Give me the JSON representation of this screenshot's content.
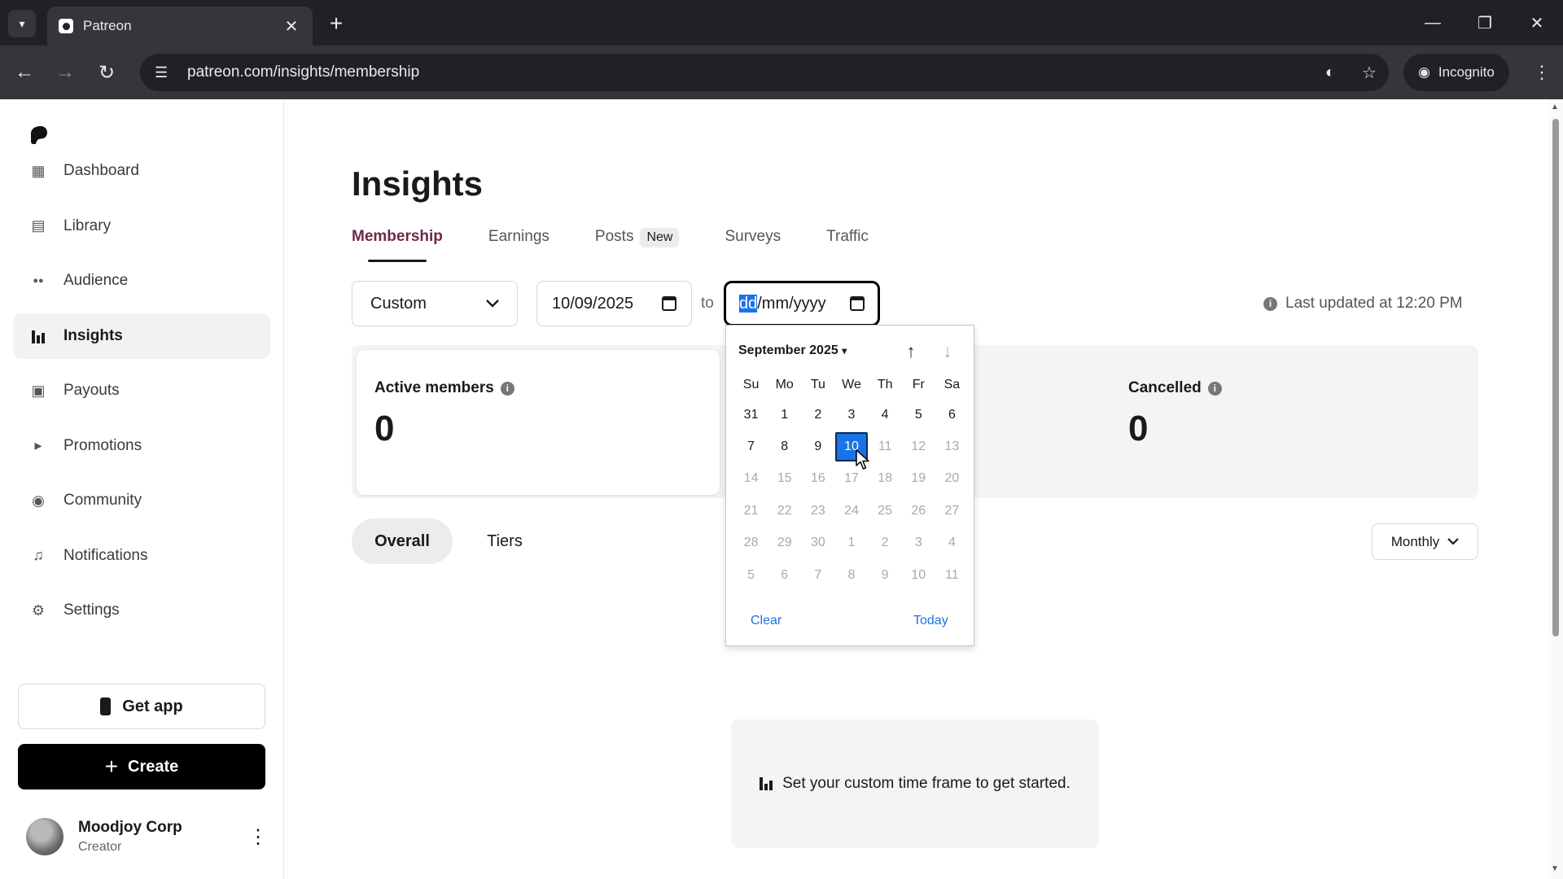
{
  "browser": {
    "tab_title": "Patreon",
    "url": "patreon.com/insights/membership",
    "incognito_label": "Incognito"
  },
  "sidebar": {
    "items": [
      {
        "label": "Dashboard",
        "icon": "dashboard-icon"
      },
      {
        "label": "Library",
        "icon": "library-icon"
      },
      {
        "label": "Audience",
        "icon": "audience-icon"
      },
      {
        "label": "Insights",
        "icon": "insights-icon",
        "active": true
      },
      {
        "label": "Payouts",
        "icon": "payouts-icon"
      },
      {
        "label": "Promotions",
        "icon": "promotions-icon"
      },
      {
        "label": "Community",
        "icon": "community-icon"
      },
      {
        "label": "Notifications",
        "icon": "bell-icon"
      },
      {
        "label": "Settings",
        "icon": "gear-icon"
      }
    ],
    "get_app_label": "Get app",
    "create_label": "Create",
    "profile": {
      "name": "Moodjoy Corp",
      "role": "Creator"
    }
  },
  "main": {
    "title": "Insights",
    "tabs": [
      {
        "label": "Membership",
        "active": true
      },
      {
        "label": "Earnings"
      },
      {
        "label": "Posts",
        "badge": "New"
      },
      {
        "label": "Surveys"
      },
      {
        "label": "Traffic"
      }
    ],
    "range_select": "Custom",
    "date_from": "10/09/2025",
    "to_label": "to",
    "date_to": {
      "dd": "dd",
      "rest": "/mm/yyyy"
    },
    "last_updated": "Last updated at 12:20 PM",
    "stats": {
      "active_members": {
        "label": "Active members",
        "value": "0"
      },
      "cancelled": {
        "label": "Cancelled",
        "value": "0"
      }
    },
    "segments": {
      "overall": "Overall",
      "tiers": "Tiers"
    },
    "interval": "Monthly",
    "empty_message": "Set your custom time frame to get started."
  },
  "calendar": {
    "month_label": "September 2025",
    "weekdays": [
      "Su",
      "Mo",
      "Tu",
      "We",
      "Th",
      "Fr",
      "Sa"
    ],
    "days": [
      {
        "d": "31",
        "muted": false
      },
      {
        "d": "1",
        "muted": false
      },
      {
        "d": "2",
        "muted": false
      },
      {
        "d": "3",
        "muted": false
      },
      {
        "d": "4",
        "muted": false
      },
      {
        "d": "5",
        "muted": false
      },
      {
        "d": "6",
        "muted": false
      },
      {
        "d": "7",
        "muted": false
      },
      {
        "d": "8",
        "muted": false
      },
      {
        "d": "9",
        "muted": false
      },
      {
        "d": "10",
        "muted": false,
        "selected": true
      },
      {
        "d": "11",
        "muted": true
      },
      {
        "d": "12",
        "muted": true
      },
      {
        "d": "13",
        "muted": true
      },
      {
        "d": "14",
        "muted": true
      },
      {
        "d": "15",
        "muted": true
      },
      {
        "d": "16",
        "muted": true
      },
      {
        "d": "17",
        "muted": true
      },
      {
        "d": "18",
        "muted": true
      },
      {
        "d": "19",
        "muted": true
      },
      {
        "d": "20",
        "muted": true
      },
      {
        "d": "21",
        "muted": true
      },
      {
        "d": "22",
        "muted": true
      },
      {
        "d": "23",
        "muted": true
      },
      {
        "d": "24",
        "muted": true
      },
      {
        "d": "25",
        "muted": true
      },
      {
        "d": "26",
        "muted": true
      },
      {
        "d": "27",
        "muted": true
      },
      {
        "d": "28",
        "muted": true
      },
      {
        "d": "29",
        "muted": true
      },
      {
        "d": "30",
        "muted": true
      },
      {
        "d": "1",
        "muted": true
      },
      {
        "d": "2",
        "muted": true
      },
      {
        "d": "3",
        "muted": true
      },
      {
        "d": "4",
        "muted": true
      },
      {
        "d": "5",
        "muted": true
      },
      {
        "d": "6",
        "muted": true
      },
      {
        "d": "7",
        "muted": true
      },
      {
        "d": "8",
        "muted": true
      },
      {
        "d": "9",
        "muted": true
      },
      {
        "d": "10",
        "muted": true
      },
      {
        "d": "11",
        "muted": true
      }
    ],
    "clear_label": "Clear",
    "today_label": "Today"
  },
  "colors": {
    "accent": "#1a73e8",
    "active_tab": "#6b2a4a"
  }
}
